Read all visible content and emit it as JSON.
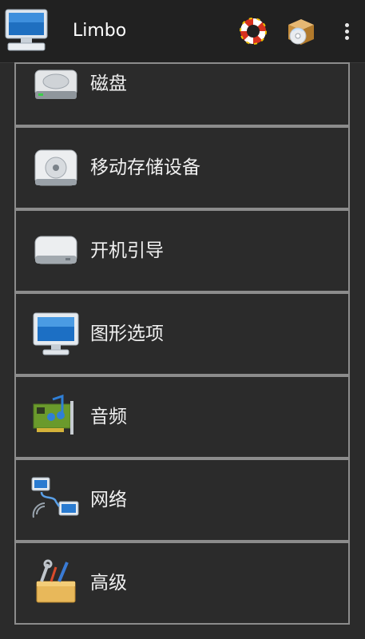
{
  "app_bar": {
    "title": "Limbo",
    "actions": [
      {
        "name": "help-lifebuoy-button",
        "icon": "lifebuoy-icon"
      },
      {
        "name": "install-package-button",
        "icon": "package-disc-icon"
      }
    ],
    "overflow_icon": "more-vert-icon"
  },
  "menu": {
    "items": [
      {
        "label": "磁盘",
        "icon": "hard-disk-icon"
      },
      {
        "label": "移动存储设备",
        "icon": "optical-drive-icon"
      },
      {
        "label": "开机引导",
        "icon": "removable-drive-icon"
      },
      {
        "label": "图形选项",
        "icon": "monitor-icon"
      },
      {
        "label": "音频",
        "icon": "sound-card-icon"
      },
      {
        "label": "网络",
        "icon": "network-icon"
      },
      {
        "label": "高级",
        "icon": "tools-box-icon"
      }
    ]
  },
  "colors": {
    "background": "#2b2b2b",
    "app_bar": "#212121",
    "item_border": "#8c8c8c",
    "text": "#f0f0f0"
  }
}
